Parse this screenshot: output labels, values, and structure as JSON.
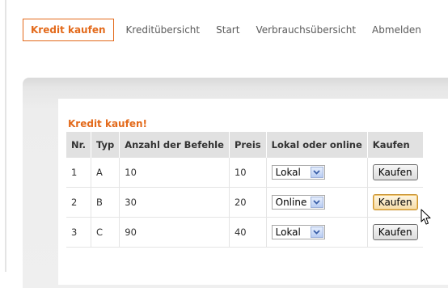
{
  "nav": {
    "items": [
      {
        "label": "Kredit kaufen",
        "active": true
      },
      {
        "label": "Kreditübersicht",
        "active": false
      },
      {
        "label": "Start",
        "active": false
      },
      {
        "label": "Verbrauchsübersicht",
        "active": false
      },
      {
        "label": "Abmelden",
        "active": false
      }
    ]
  },
  "card": {
    "title": "Kredit kaufen!"
  },
  "table": {
    "headers": [
      "Nr.",
      "Typ",
      "Anzahl der Befehle",
      "Preis",
      "Lokal oder online",
      "Kaufen"
    ],
    "rows": [
      {
        "nr": "1",
        "typ": "A",
        "anzahl": "10",
        "preis": "10",
        "mode": "Lokal",
        "button": "Kaufen"
      },
      {
        "nr": "2",
        "typ": "B",
        "anzahl": "30",
        "preis": "20",
        "mode": "Online",
        "button": "Kaufen"
      },
      {
        "nr": "3",
        "typ": "C",
        "anzahl": "90",
        "preis": "40",
        "mode": "Lokal",
        "button": "Kaufen"
      }
    ]
  },
  "icons": {
    "select_arrow": "chevron-down-icon",
    "cursor": "mouse-pointer-icon"
  },
  "colors": {
    "accent": "#e36a1b",
    "header_bg": "#e1e1e1",
    "panel_bg": "#ededed"
  }
}
